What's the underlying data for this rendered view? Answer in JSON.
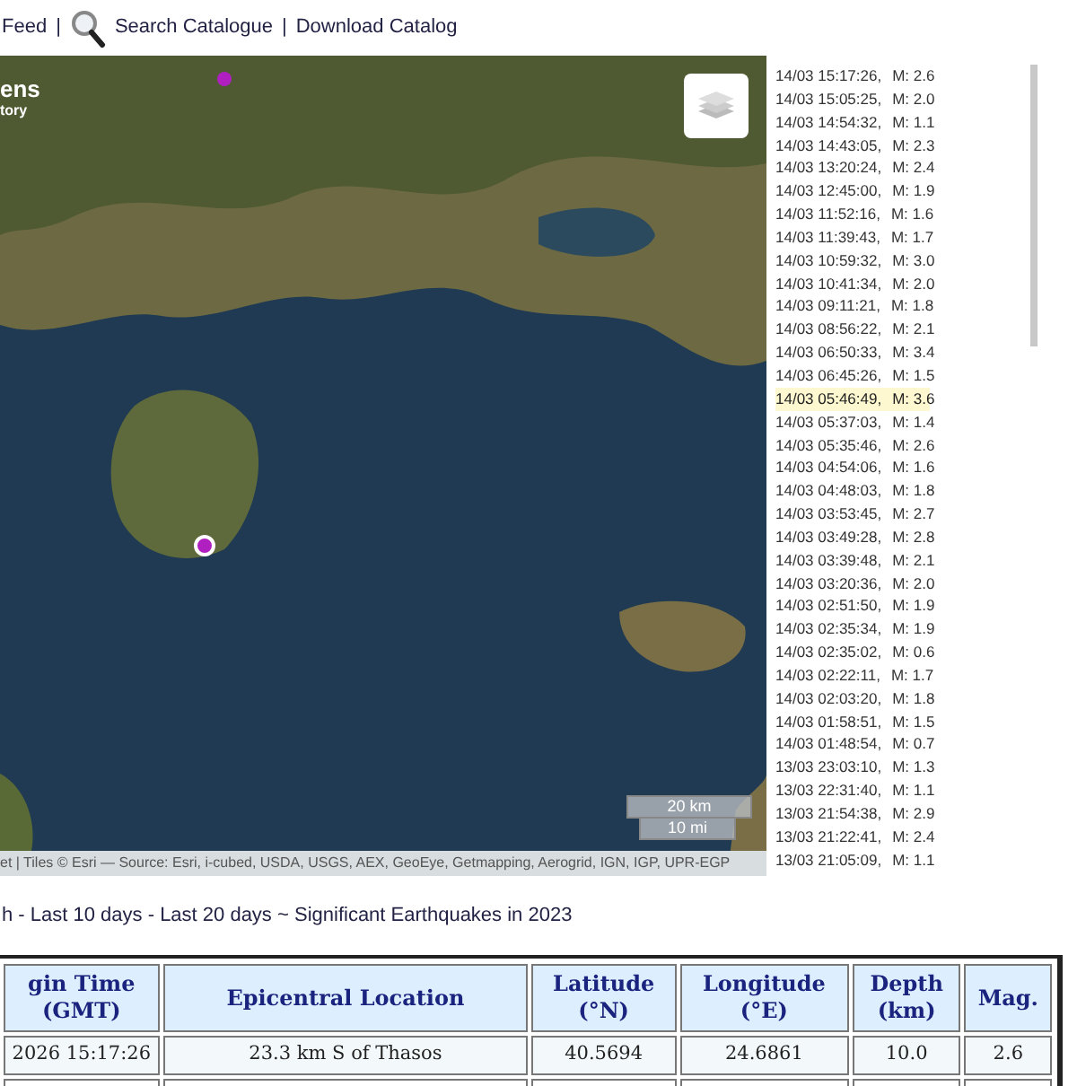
{
  "top_links": [
    {
      "label": "Feed"
    },
    {
      "sep": "|",
      "label": "Search Catalogue",
      "icon": true
    },
    {
      "sep": "|",
      "label": "Download Catalog"
    }
  ],
  "map": {
    "overlay_title": "ens",
    "overlay_subtitle": "tory",
    "attribution": "et | Tiles © Esri — Source: Esri, i-cubed, USDA, USGS, AEX, GeoEye, Getmapping, Aerogrid, IGN, IGP, UPR-EGP",
    "scale": [
      "20 km",
      "10 mi"
    ],
    "markers": [
      {
        "selected": false
      },
      {
        "selected": true
      }
    ]
  },
  "events": [
    {
      "time": "14/03 15:17:26,",
      "mag": "M: 2.6",
      "selected": false
    },
    {
      "time": "14/03 15:05:25,",
      "mag": "M: 2.0",
      "selected": false
    },
    {
      "time": "14/03 14:54:32,",
      "mag": "M: 1.1",
      "selected": false
    },
    {
      "time": "14/03 14:43:05,",
      "mag": "M: 2.3",
      "selected": false
    },
    {
      "time": "14/03 13:20:24,",
      "mag": "M: 2.4",
      "selected": false
    },
    {
      "time": "14/03 12:45:00,",
      "mag": "M: 1.9",
      "selected": false
    },
    {
      "time": "14/03 11:52:16,",
      "mag": "M: 1.6",
      "selected": false
    },
    {
      "time": "14/03 11:39:43,",
      "mag": "M: 1.7",
      "selected": false
    },
    {
      "time": "14/03 10:59:32,",
      "mag": "M: 3.0",
      "selected": false
    },
    {
      "time": "14/03 10:41:34,",
      "mag": "M: 2.0",
      "selected": false
    },
    {
      "time": "14/03 09:11:21,",
      "mag": "M: 1.8",
      "selected": false
    },
    {
      "time": "14/03 08:56:22,",
      "mag": "M: 2.1",
      "selected": false
    },
    {
      "time": "14/03 06:50:33,",
      "mag": "M: 3.4",
      "selected": false
    },
    {
      "time": "14/03 06:45:26,",
      "mag": "M: 1.5",
      "selected": false
    },
    {
      "time": "14/03 05:46:49,",
      "mag": "M: 3.6",
      "selected": true
    },
    {
      "time": "14/03 05:37:03,",
      "mag": "M: 1.4",
      "selected": false
    },
    {
      "time": "14/03 05:35:46,",
      "mag": "M: 2.6",
      "selected": false
    },
    {
      "time": "14/03 04:54:06,",
      "mag": "M: 1.6",
      "selected": false
    },
    {
      "time": "14/03 04:48:03,",
      "mag": "M: 1.8",
      "selected": false
    },
    {
      "time": "14/03 03:53:45,",
      "mag": "M: 2.7",
      "selected": false
    },
    {
      "time": "14/03 03:49:28,",
      "mag": "M: 2.8",
      "selected": false
    },
    {
      "time": "14/03 03:39:48,",
      "mag": "M: 2.1",
      "selected": false
    },
    {
      "time": "14/03 03:20:36,",
      "mag": "M: 2.0",
      "selected": false
    },
    {
      "time": "14/03 02:51:50,",
      "mag": "M: 1.9",
      "selected": false
    },
    {
      "time": "14/03 02:35:34,",
      "mag": "M: 1.9",
      "selected": false
    },
    {
      "time": "14/03 02:35:02,",
      "mag": "M: 0.6",
      "selected": false
    },
    {
      "time": "14/03 02:22:11,",
      "mag": "M: 1.7",
      "selected": false
    },
    {
      "time": "14/03 02:03:20,",
      "mag": "M: 1.8",
      "selected": false
    },
    {
      "time": "14/03 01:58:51,",
      "mag": "M: 1.5",
      "selected": false
    },
    {
      "time": "14/03 01:48:54,",
      "mag": "M: 0.7",
      "selected": false
    },
    {
      "time": "13/03 23:03:10,",
      "mag": "M: 1.3",
      "selected": false
    },
    {
      "time": "13/03 22:31:40,",
      "mag": "M: 1.1",
      "selected": false
    },
    {
      "time": "13/03 21:54:38,",
      "mag": "M: 2.9",
      "selected": false
    },
    {
      "time": "13/03 21:22:41,",
      "mag": "M: 2.4",
      "selected": false
    },
    {
      "time": "13/03 21:05:09,",
      "mag": "M: 1.1",
      "selected": false
    }
  ],
  "period_links": [
    {
      "label": "h"
    },
    {
      "sep": " - ",
      "label": "Last 10 days"
    },
    {
      "sep": " - ",
      "label": "Last 20 days"
    },
    {
      "sep": " ~ ",
      "label": "Significant Earthquakes in 2023"
    }
  ],
  "table": {
    "columns": [
      "gin Time\n(GMT)",
      "Epicentral Location",
      "Latitude\n(°N)",
      "Longitude\n(°E)",
      "Depth\n(km)",
      "Mag."
    ],
    "rows": [
      [
        "2026 15:17:26",
        "23.3 km S of Thasos",
        "40.5694",
        "24.6861",
        "10.0",
        "2.6"
      ]
    ]
  }
}
